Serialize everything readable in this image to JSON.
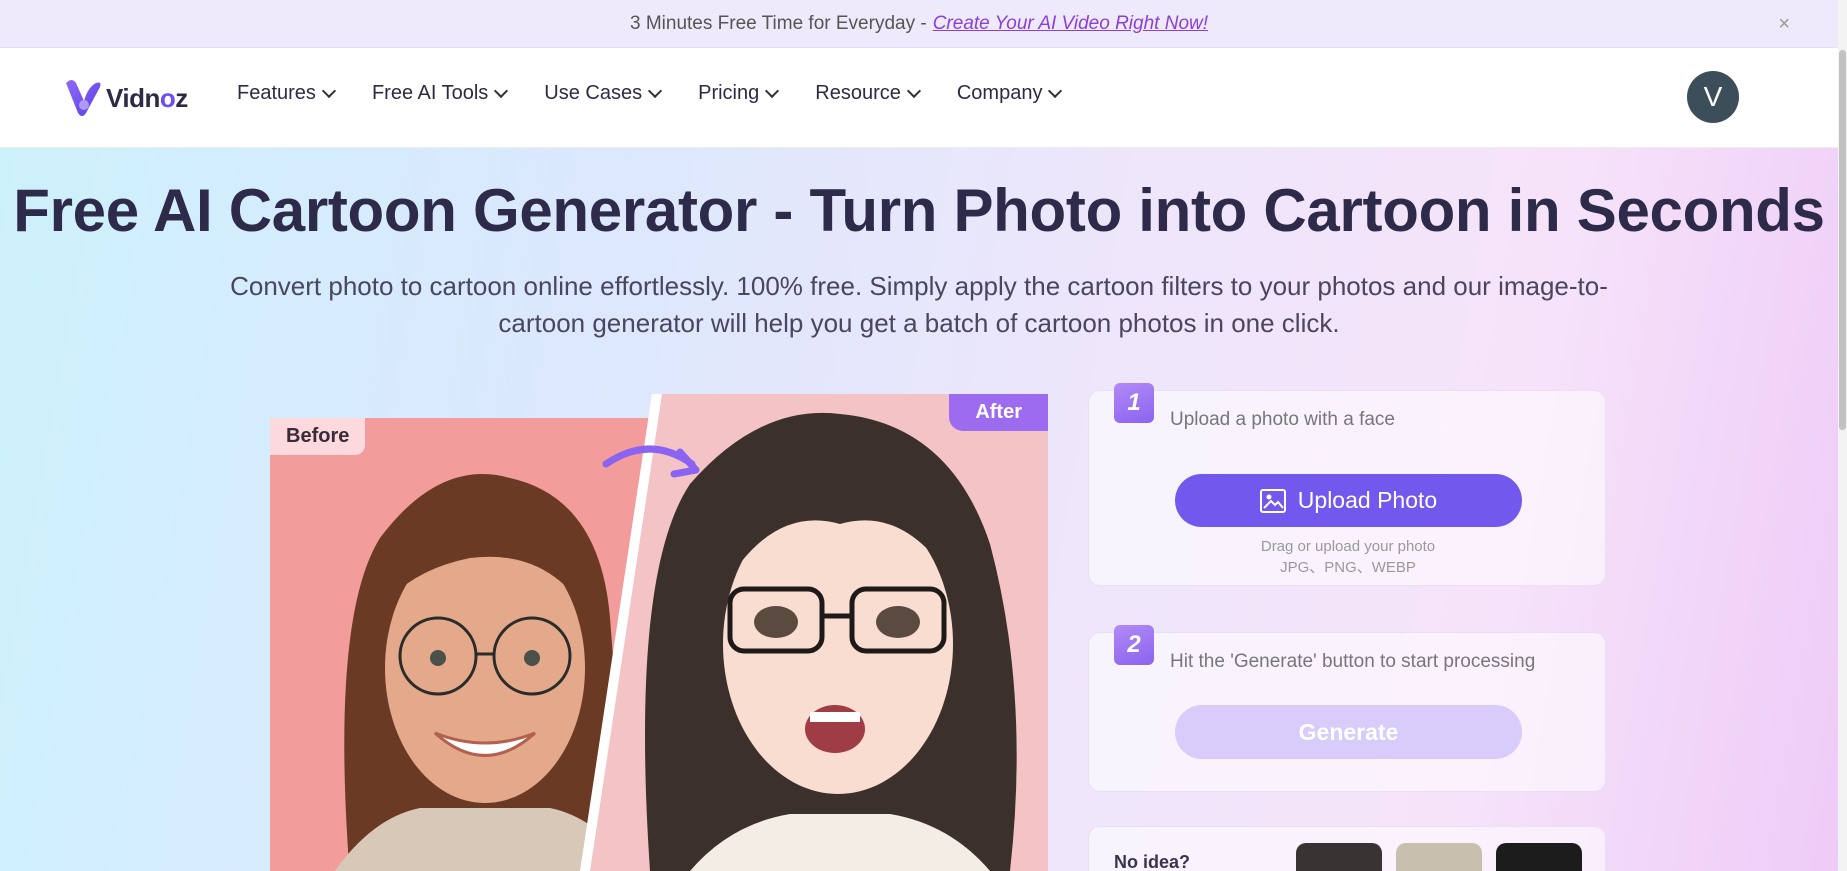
{
  "promo": {
    "text": "3 Minutes Free Time for Everyday -",
    "link": "Create Your AI Video Right Now!",
    "close": "×"
  },
  "nav": {
    "logo": "Vidnoz",
    "items": [
      {
        "label": "Features"
      },
      {
        "label": "Free AI Tools"
      },
      {
        "label": "Use Cases"
      },
      {
        "label": "Pricing"
      },
      {
        "label": "Resource"
      },
      {
        "label": "Company"
      }
    ],
    "avatar": "V"
  },
  "hero": {
    "title": "Free AI Cartoon Generator - Turn Photo into Cartoon in Seconds",
    "subtitle": "Convert photo to cartoon online effortlessly. 100% free. Simply apply the cartoon filters to your photos and our image-to-cartoon generator will help you get a batch of cartoon photos in one click."
  },
  "compare": {
    "before_label": "Before",
    "after_label": "After"
  },
  "step1": {
    "num": "1",
    "text": "Upload a photo with a face",
    "button": "Upload Photo",
    "hint": "Drag or upload your photo",
    "formats": "JPG、PNG、WEBP"
  },
  "step2": {
    "num": "2",
    "text": "Hit the 'Generate' button to start processing",
    "button": "Generate"
  },
  "samples": {
    "label": "No idea?"
  },
  "colors": {
    "accent": "#7358ee",
    "title": "#2d2a4a",
    "link": "#8a3fd8"
  }
}
